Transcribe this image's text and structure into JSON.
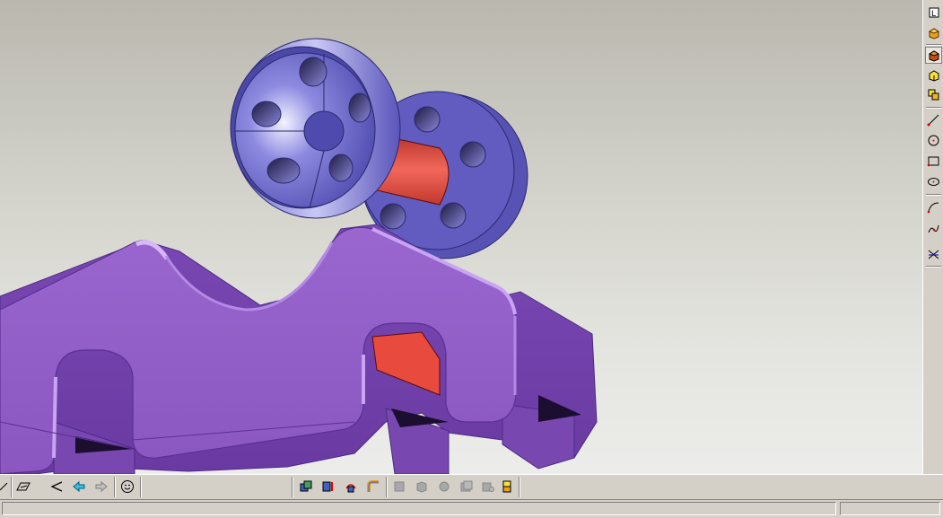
{
  "app": {
    "accent_color": "#0a246a",
    "background_color": "#d4d0c8"
  },
  "viewport": {
    "model_colors": {
      "rails": "#8a58c0",
      "rails_edge": "#6e3ea6",
      "wheels": "#5c56b8",
      "wheels_edge": "#2a2870",
      "axle": "#e84a3e"
    }
  },
  "right_toolbar": {
    "tools": [
      "view-fit-icon",
      "shaded-box-icon",
      "shaded-box-edges-icon",
      "yellow-box-icon",
      "multi-box-icon",
      "line-tool-icon",
      "circle-tool-icon",
      "rectangle-tool-icon",
      "ellipse-tool-icon",
      "arc-tool-icon",
      "spline-tool-icon",
      "trim-tool-icon"
    ]
  },
  "bottom_toolbar": {
    "tools": [
      "zoom-icon",
      "plane-dropdown-icon",
      "previous-view-icon",
      "back-arrow-icon",
      "forward-arrow-icon",
      "smiley-icon",
      "assembly-box-icon",
      "boolean-icon",
      "rotate-part-icon",
      "sweep-icon",
      "disabled-fillet-icon",
      "disabled-shell-icon",
      "disabled-revolve-icon",
      "disabled-extrude-icon",
      "disabled-pattern-icon",
      "cube-stack-icon"
    ]
  },
  "status_bar": {
    "message": ""
  }
}
